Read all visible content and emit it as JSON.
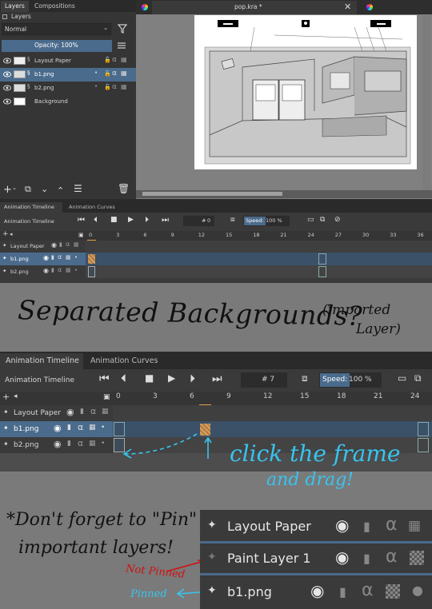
{
  "layers_docker": {
    "tabs": [
      "Layers",
      "Compositions"
    ],
    "title": "Layers",
    "blend_mode": "Normal",
    "opacity_label": "Opacity:  100%",
    "layers": [
      {
        "name": "Layout Paper",
        "selected": false
      },
      {
        "name": "b1.png",
        "selected": true
      },
      {
        "name": "b2.png",
        "selected": false
      },
      {
        "name": "Background",
        "selected": false
      }
    ]
  },
  "canvas": {
    "tab_title": "pop.kra *"
  },
  "timeline1": {
    "tabs": [
      "Animation Timeline",
      "Animation Curves"
    ],
    "title": "Animation Timeline",
    "frame_value": "0",
    "speed_label": "Speed:",
    "speed_value": "100 %",
    "frame_ticks": [
      "0",
      "3",
      "6",
      "9",
      "12",
      "15",
      "18",
      "21",
      "24",
      "27",
      "30",
      "33",
      "36"
    ],
    "layers": [
      "Layout Paper",
      "b1.png",
      "b2.png"
    ]
  },
  "caption1": {
    "main": "Separated Backgrounds?",
    "note_line1": "(imported",
    "note_line2": "Layer)"
  },
  "timeline2": {
    "tabs": [
      "Animation Timeline",
      "Animation Curves"
    ],
    "title": "Animation Timeline",
    "frame_value": "# 7",
    "speed_label": "Speed:",
    "speed_value": "100 %",
    "frame_ticks": [
      "0",
      "3",
      "6",
      "9",
      "12",
      "15",
      "18",
      "21",
      "24"
    ],
    "layers": [
      "Layout Paper",
      "b1.png",
      "b2.png"
    ]
  },
  "caption2": {
    "line1": "click the frame",
    "line2": "and drag!"
  },
  "caption3": {
    "line1": "*Don't forget to \"Pin\"",
    "line2": "important layers!",
    "not_pinned": "Not Pinned",
    "pinned": "Pinned"
  },
  "zoom_panel": {
    "layers": [
      "Layout Paper",
      "Paint Layer 1",
      "b1.png"
    ]
  },
  "colors": {
    "accent_blue": "#4a6b8c",
    "orange": "#e0a040",
    "cyan_annot": "#39c4ee",
    "red_annot": "#d01010"
  }
}
